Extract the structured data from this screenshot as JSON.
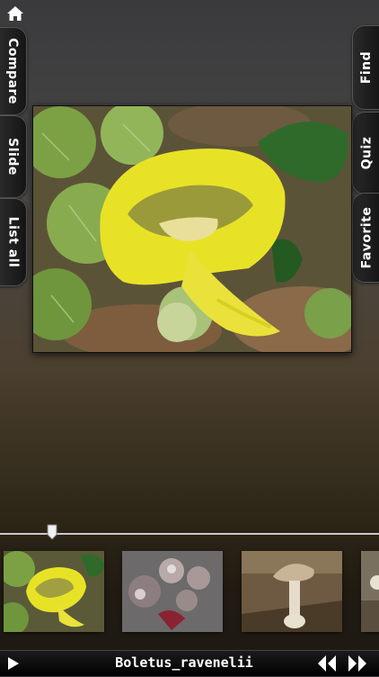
{
  "sidebar_left": [
    {
      "label": "Compare"
    },
    {
      "label": "Slide"
    },
    {
      "label": "List all"
    }
  ],
  "sidebar_right": [
    {
      "label": "Find"
    },
    {
      "label": "Quiz"
    },
    {
      "label": "Favorite"
    }
  ],
  "icons": {
    "home": "home-icon",
    "play": "play-icon",
    "prev": "rewind-icon",
    "next": "fast-forward-icon"
  },
  "footer": {
    "species_name": "Boletus_ravenelii"
  },
  "colors": {
    "mushroom_cap": "#e8e227",
    "moss": "#8fb04a",
    "tab_bg": "#1a1a1a"
  }
}
